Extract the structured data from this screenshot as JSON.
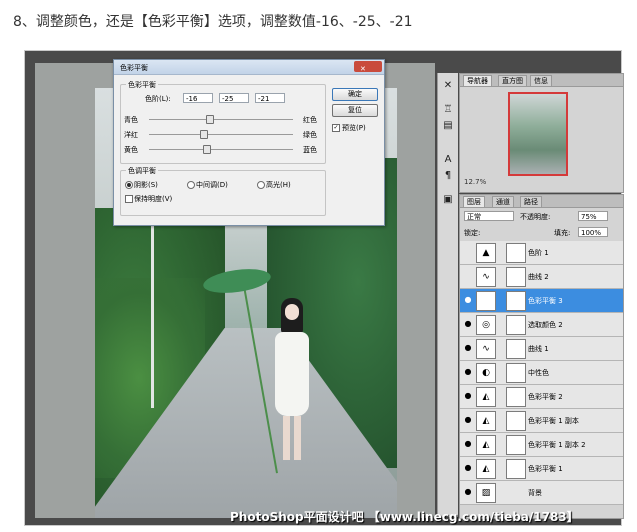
{
  "heading": "8、调整颜色，还是【色彩平衡】选项，调整数值-16、-25、-21",
  "dialog": {
    "title": "色彩平衡",
    "close": "✕",
    "group_balance": "色彩平衡",
    "levels_label": "色阶(L):",
    "levels": [
      "-16",
      "-25",
      "-21"
    ],
    "sliders": [
      {
        "left": "青色",
        "right": "红色",
        "value": -16
      },
      {
        "left": "洋红",
        "right": "绿色",
        "value": -25
      },
      {
        "left": "黄色",
        "right": "蓝色",
        "value": -21
      }
    ],
    "group_tone": "色调平衡",
    "tones": [
      "阴影(S)",
      "中间调(D)",
      "高光(H)"
    ],
    "selected_tone": 0,
    "preserve": "保持明度(V)",
    "ok": "确定",
    "reset": "复位",
    "preview": "预览(P)",
    "preview_check": "✓"
  },
  "navigator": {
    "tabs": [
      "导航器",
      "直方图",
      "信息"
    ],
    "zoom": "12.7%"
  },
  "layers_panel": {
    "tabs": [
      "图层",
      "通道",
      "路径"
    ],
    "blend_mode": "正常",
    "opacity_label": "不透明度:",
    "opacity": "75%",
    "lock_label": "锁定:",
    "fill_label": "填充:",
    "fill": "100%",
    "layers": [
      {
        "name": "色阶 1",
        "visible": false,
        "icon": "levels-icon",
        "selected": false
      },
      {
        "name": "曲线 2",
        "visible": false,
        "icon": "curves-icon",
        "selected": false
      },
      {
        "name": "色彩平衡 3",
        "visible": true,
        "icon": "balance-icon",
        "selected": true
      },
      {
        "name": "选取颜色 2",
        "visible": true,
        "icon": "selective-color-icon",
        "selected": false
      },
      {
        "name": "曲线 1",
        "visible": true,
        "icon": "curves-icon",
        "selected": false
      },
      {
        "name": "中性色",
        "visible": true,
        "icon": "neutral-icon",
        "selected": false
      },
      {
        "name": "色彩平衡 2",
        "visible": true,
        "icon": "balance-icon",
        "selected": false
      },
      {
        "name": "色彩平衡 1 副本",
        "visible": true,
        "icon": "balance-icon",
        "selected": false
      },
      {
        "name": "色彩平衡 1 副本 2",
        "visible": true,
        "icon": "balance-icon",
        "selected": false
      },
      {
        "name": "色彩平衡 1",
        "visible": true,
        "icon": "balance-icon",
        "selected": false
      },
      {
        "name": "背景",
        "visible": true,
        "icon": "background-icon",
        "selected": false
      }
    ]
  },
  "watermark": "PhotoShop平面设计吧 【www.linecg.com/tieba/1783】"
}
